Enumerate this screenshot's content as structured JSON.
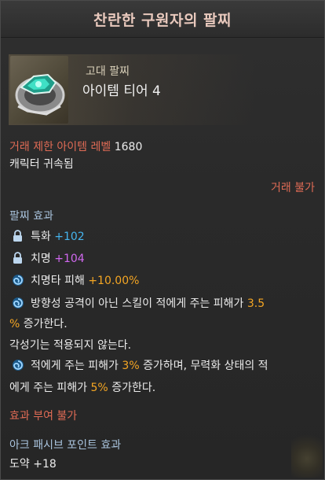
{
  "title": "찬란한 구원자의 팔찌",
  "item": {
    "grade": "고대 팔찌",
    "tier": "아이템 티어 4",
    "icon": "bracelet-icon"
  },
  "trade_level": {
    "label": "거래 제한 아이템 레벨",
    "value": "1680"
  },
  "bind": "캐릭터 귀속됨",
  "trade": "거래 불가",
  "bracelet_effect": {
    "heading": "팔찌 효과",
    "stats": [
      {
        "icon": "lock-icon",
        "name": "특화",
        "value": "+102",
        "color": "#45b4ee"
      },
      {
        "icon": "lock-icon",
        "name": "치명",
        "value": "+104",
        "color": "#d168f0"
      }
    ],
    "crit_damage": {
      "icon": "swirl-icon",
      "name": "치명타 피해",
      "value": "+10.00%"
    },
    "directional": {
      "icon": "swirl-icon",
      "line1_prefix": "방향성 공격이 아닌 스킬이 적에게 주는 피해가",
      "line1_value": "3.5",
      "line2_unit": "%",
      "line2_suffix": "증가한다.",
      "line3": "각성기는 적용되지 않는다."
    },
    "enemy_dmg": {
      "icon": "swirl-icon",
      "line1_prefix": "적에게 주는 피해가",
      "line1_value": "3%",
      "line1_suffix": "증가하며, 무력화 상태의 적",
      "line2_prefix": "에게 주는 피해가",
      "line2_value": "5%",
      "line2_suffix": "증가한다."
    }
  },
  "no_effect": "효과 부여 불가",
  "ark_passive": {
    "heading": "아크 패시브 포인트 효과",
    "value": "도약 +18"
  },
  "colors": {
    "title": "#e9c9bd",
    "red": "#e06b55",
    "blue_heading": "#a9c3dd",
    "light_blue": "#45b4ee",
    "purple": "#d168f0",
    "orange": "#f5a623"
  }
}
